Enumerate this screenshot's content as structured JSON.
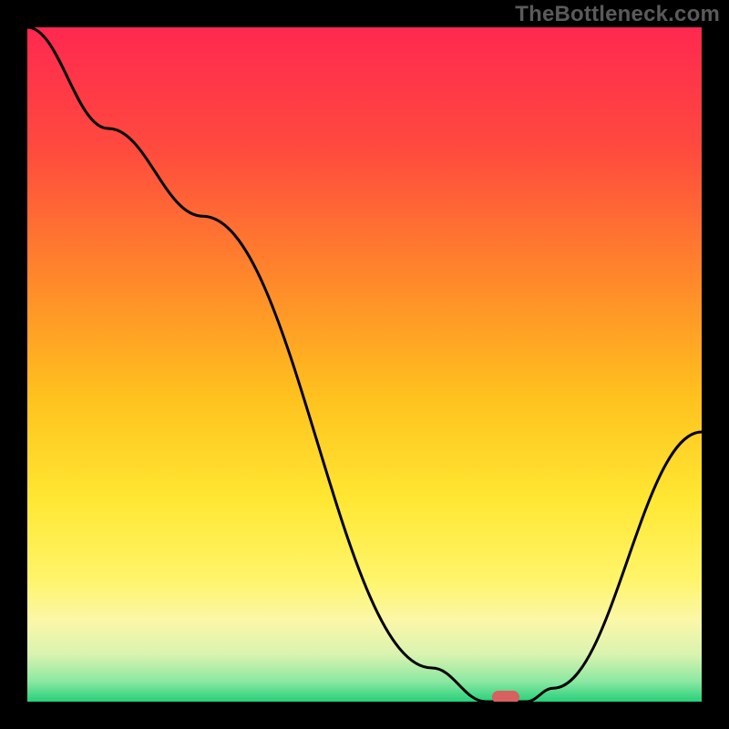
{
  "watermark": "TheBottleneck.com",
  "chart_data": {
    "type": "line",
    "title": "",
    "xlabel": "",
    "ylabel": "",
    "xlim": [
      0,
      100
    ],
    "ylim": [
      0,
      100
    ],
    "series": [
      {
        "name": "curve",
        "x": [
          0,
          12,
          26,
          60,
          68,
          74,
          78,
          100
        ],
        "values": [
          100,
          85,
          72,
          5,
          0,
          0,
          2,
          40
        ]
      }
    ],
    "marker": {
      "x": 71,
      "y": 0,
      "color": "#d86060"
    },
    "gradient_stops": [
      {
        "pos": 0.0,
        "color": "#ff2850"
      },
      {
        "pos": 0.18,
        "color": "#ff4a3e"
      },
      {
        "pos": 0.38,
        "color": "#ff8a2a"
      },
      {
        "pos": 0.55,
        "color": "#ffc21e"
      },
      {
        "pos": 0.7,
        "color": "#ffe733"
      },
      {
        "pos": 0.82,
        "color": "#fff56b"
      },
      {
        "pos": 0.88,
        "color": "#fbf7a8"
      },
      {
        "pos": 0.93,
        "color": "#d9f3b0"
      },
      {
        "pos": 0.97,
        "color": "#8be8a2"
      },
      {
        "pos": 1.0,
        "color": "#27d07a"
      }
    ]
  }
}
